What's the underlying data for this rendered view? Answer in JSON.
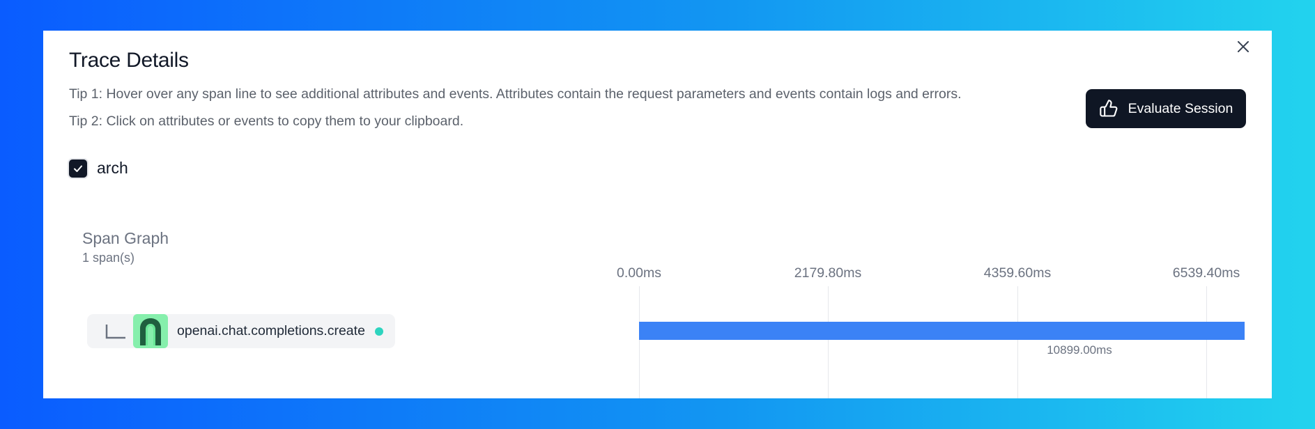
{
  "modal": {
    "title": "Trace Details",
    "tip1": "Tip 1: Hover over any span line to see additional attributes and events. Attributes contain the request parameters and events contain logs and errors.",
    "tip2": "Tip 2: Click on attributes or events to copy them to your clipboard.",
    "close_icon": "close-icon"
  },
  "evaluate_button": {
    "label": "Evaluate Session",
    "icon": "thumbs-up-icon"
  },
  "filter": {
    "label": "arch",
    "checked": true
  },
  "span_graph": {
    "title": "Span Graph",
    "count": "1 span(s)",
    "ticks": [
      "0.00ms",
      "2179.80ms",
      "4359.60ms",
      "6539.40ms"
    ],
    "spans": [
      {
        "name": "openai.chat.completions.create",
        "duration": "10899.00ms",
        "status_color": "#2dd4bf",
        "bar_color": "#3b82f6",
        "icon": "arch-logo-icon"
      }
    ]
  }
}
